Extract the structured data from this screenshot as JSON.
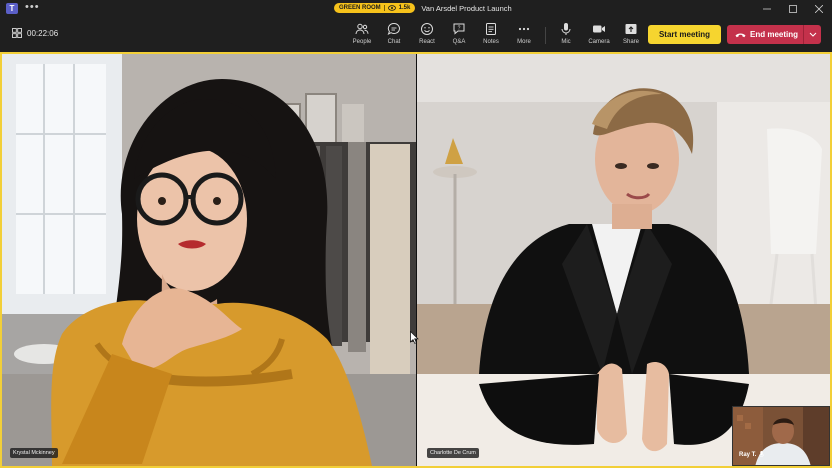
{
  "titlebar": {
    "app_icon": "teams-icon",
    "more_label": "•••",
    "green_room_label": "GREEN ROOM",
    "attendee_count": "1.5k",
    "meeting_title": "Van Arsdel Product Launch",
    "window_controls": [
      "minimize-icon",
      "maximize-icon",
      "close-icon"
    ]
  },
  "toolbar": {
    "timer": "00:22:06",
    "items": [
      {
        "label": "People",
        "icon": "people-icon"
      },
      {
        "label": "Chat",
        "icon": "chat-icon"
      },
      {
        "label": "React",
        "icon": "react-icon"
      },
      {
        "label": "Q&A",
        "icon": "qna-icon"
      },
      {
        "label": "Notes",
        "icon": "notes-icon"
      },
      {
        "label": "More",
        "icon": "more-icon"
      },
      {
        "label": "Mic",
        "icon": "mic-icon"
      },
      {
        "label": "Camera",
        "icon": "camera-icon"
      },
      {
        "label": "Share",
        "icon": "share-icon"
      }
    ],
    "start_label": "Start meeting",
    "end_label": "End meeting",
    "colors": {
      "start": "#f6d52f",
      "end": "#c4314b",
      "frame": "#f2cf38"
    }
  },
  "participants": {
    "left": {
      "name": "Krystal Mckinney"
    },
    "right": {
      "name": "Charlotte De Crum"
    },
    "pip": {
      "name": "Ray T."
    }
  }
}
